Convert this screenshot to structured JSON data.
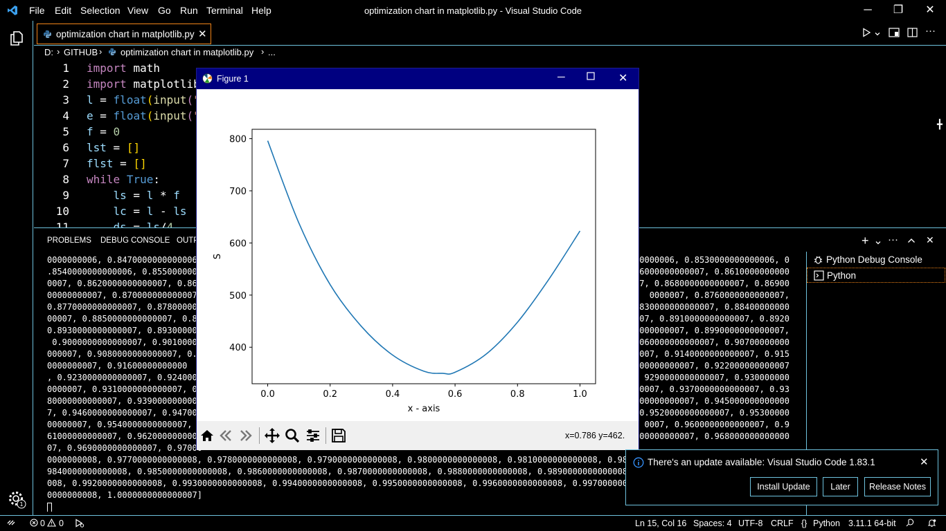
{
  "window": {
    "title": "optimization chart in matplotlib.py - Visual Studio Code",
    "menu": [
      "File",
      "Edit",
      "Selection",
      "View",
      "Go",
      "Run",
      "Terminal",
      "Help"
    ]
  },
  "editor": {
    "tab_label": "optimization chart in matplotlib.py",
    "breadcrumb": [
      "D:",
      "GITHUB",
      "optimization chart in matplotlib.py",
      "..."
    ],
    "line_numbers": [
      "1",
      "2",
      "3",
      "4",
      "5",
      "6",
      "7",
      "8",
      "9",
      "10",
      "11"
    ]
  },
  "panel": {
    "tabs": [
      "PROBLEMS",
      "DEBUG CONSOLE",
      "OUTP"
    ],
    "terminals": [
      "Python Debug Console",
      "Python"
    ],
    "terminal_left": [
      "0000000006, 0.8470000000000006,",
      ".8540000000000006, 0.855000000",
      "0007, 0.8620000000000007, 0.863",
      "00000000007, 0.870000000000007",
      "0.8770000000000007, 0.878000000",
      "00007, 0.8850000000000007, 0.88",
      "0.8930000000000007, 0.8930000000",
      " 0.9000000000000007, 0.90100000",
      "000007, 0.9080000000000007, 0.9",
      "0000000007, 0.91600000000000",
      ", 0.9230000000000007, 0.924000",
      "0000007, 0.9310000000000007, 0.",
      "80000000000007, 0.9390000000000",
      "7, 0.9460000000000007, 0.94700",
      "00000007, 0.9540000000000007, 0",
      "61000000000007, 0.962000000000",
      "07, 0.9690000000000007, 0.97000",
      "0000000008, 0.9770000000000008, 0.9780000000000008, 0.9790000000000008, 0.9800000000000008, 0.9810000000000008, 0.9820000",
      "9840000000000008, 0.9850000000000008, 0.9860000000000008, 0.9870000000000008, 0.9880000000000008, 0.9890000000000008, 0",
      "008, 0.9920000000000008, 0.9930000000000008, 0.9940000000000008, 0.9950000000000008, 0.9960000000000008, 0.9970000000",
      "0000000008, 1.0000000000000007]"
    ],
    "terminal_right": [
      "0000006, 0.8530000000000006, 0",
      "6000000000007, 0.8610000000000",
      "07, 0.8680000000000007, 0.86900",
      "0000007, 0.8760000000000007,",
      "8830000000000007, 0.88400000000",
      "007, 0.8910000000000007, 0.8920",
      "0000000007, 0.8990000000000007,",
      "9060000000000007, 0.90700000000",
      "0007, 0.9140000000000007, 0.915",
      "00000000007, 0.922000000000007",
      "9290000000000007, 0.930000000",
      "0007, 0.9370000000000007, 0.93",
      "00000000007, 0.945000000000000",
      "0.9520000000000007, 0.95300000",
      "0007, 0.9600000000000007, 0.9",
      "000000000007, 0.968000000000000"
    ]
  },
  "figure": {
    "title": "Figure 1",
    "coords_readout": "x=0.786 y=462."
  },
  "chart_data": {
    "type": "line",
    "title": "",
    "xlabel": "x - axis",
    "ylabel": "S",
    "xlim": [
      -0.05,
      1.05
    ],
    "ylim": [
      330,
      818
    ],
    "xticks": [
      "0.0",
      "0.2",
      "0.4",
      "0.6",
      "0.8",
      "1.0"
    ],
    "yticks": [
      "400",
      "500",
      "600",
      "700",
      "800"
    ],
    "grid": false,
    "series": [
      {
        "color": "#1f77b4",
        "x": [
          0.0,
          0.1,
          0.2,
          0.3,
          0.4,
          0.5,
          0.56,
          0.6,
          0.7,
          0.8,
          0.9,
          1.0
        ],
        "values": [
          796,
          638,
          520,
          440,
          385,
          354,
          350,
          352,
          387,
          448,
          530,
          623
        ]
      }
    ]
  },
  "notification": {
    "message": "There's an update available: Visual Studio Code 1.83.1",
    "buttons": [
      "Install Update",
      "Later",
      "Release Notes"
    ]
  },
  "statusbar": {
    "errors": "0",
    "warnings": "0",
    "cursor": "Ln 15, Col 16",
    "spaces": "Spaces: 4",
    "encoding": "UTF-8",
    "eol": "CRLF",
    "language": "Python",
    "interpreter": "3.11.1 64-bit"
  },
  "colors": {
    "accent_border": "#6fc3df",
    "active_tab_border": "#f38518",
    "figure_titlebar": "#000080",
    "python_icon": "#3572A5"
  }
}
